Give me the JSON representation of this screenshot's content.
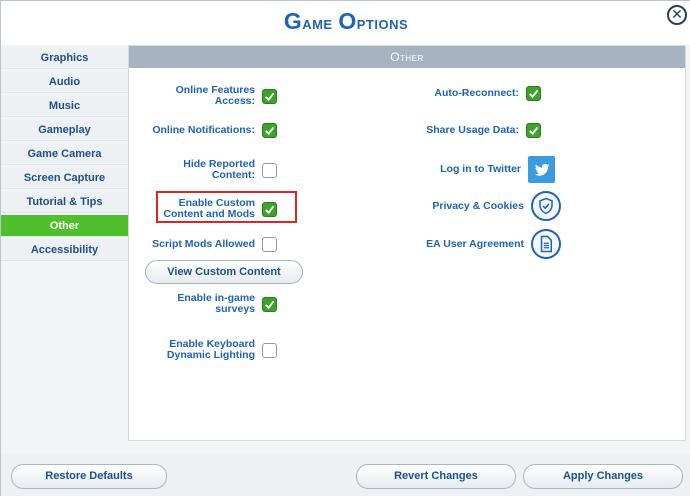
{
  "window": {
    "title_first": "G",
    "title_rest": "ame ",
    "title_second": "O",
    "title_second_rest": "ptions",
    "close_glyph": "✕"
  },
  "sidebar": {
    "items": [
      {
        "label": "Graphics"
      },
      {
        "label": "Audio"
      },
      {
        "label": "Music"
      },
      {
        "label": "Gameplay"
      },
      {
        "label": "Game Camera"
      },
      {
        "label": "Screen Capture"
      },
      {
        "label": "Tutorial & Tips"
      },
      {
        "label": "Other",
        "active": true
      },
      {
        "label": "Accessibility"
      }
    ]
  },
  "panel": {
    "heading": "Other",
    "left_options": [
      {
        "label_l1": "Online Features",
        "label_l2": "Access:",
        "checked": true
      },
      {
        "label_l1": "Online Notifications:",
        "label_l2": "",
        "checked": true
      },
      {
        "label_l1": "Hide Reported",
        "label_l2": "Content:",
        "checked": false
      },
      {
        "label_l1": "Enable Custom",
        "label_l2": "Content and Mods",
        "checked": true
      },
      {
        "label_l1": "Script Mods Allowed",
        "label_l2": "",
        "checked": false
      },
      {
        "label_l1": "Enable in-game",
        "label_l2": "surveys",
        "checked": true
      },
      {
        "label_l1": "Enable Keyboard",
        "label_l2": "Dynamic Lighting",
        "checked": false
      }
    ],
    "view_custom_content_label": "View Custom Content",
    "right_options": [
      {
        "label": "Auto-Reconnect:",
        "checked": true
      },
      {
        "label": "Share Usage Data:",
        "checked": true
      }
    ],
    "links": [
      {
        "label": "Log in to Twitter",
        "icon": "twitter-icon"
      },
      {
        "label": "Privacy & Cookies",
        "icon": "shield-check-icon"
      },
      {
        "label": "EA User Agreement",
        "icon": "document-icon"
      }
    ]
  },
  "footer": {
    "restore_label": "Restore Defaults",
    "revert_label": "Revert Changes",
    "apply_label": "Apply Changes"
  },
  "colors": {
    "accent_blue": "#1d63b8",
    "active_green": "#4fbf2e",
    "check_green": "#3ea32a",
    "highlight_red": "#e02424"
  }
}
